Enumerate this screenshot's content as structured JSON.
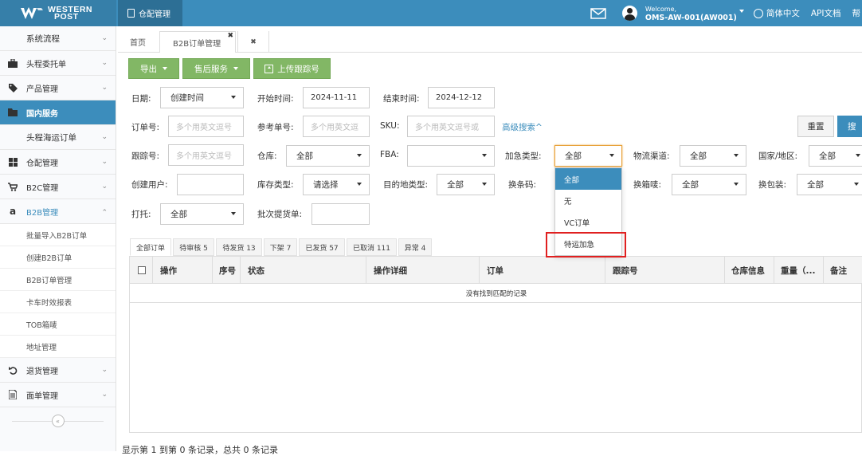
{
  "brand": {
    "line1": "WESTERN",
    "line2": "POST"
  },
  "topnav": {
    "module_tab": "仓配管理",
    "welcome": "Welcome,",
    "account": "OMS-AW-001(AW001)",
    "language": "简体中文",
    "api_docs": "API文档",
    "help": "帮"
  },
  "sidebar": {
    "items": [
      {
        "label": "系统流程",
        "icon": "",
        "chevron": "⌄"
      },
      {
        "label": "头程委托单",
        "icon": "briefcase-icon",
        "chevron": "⌄"
      },
      {
        "label": "产品管理",
        "icon": "tag-icon",
        "chevron": "⌄"
      },
      {
        "label": "国内服务",
        "icon": "folder-icon",
        "chevron": ""
      },
      {
        "label": "头程海运订单",
        "icon": "",
        "chevron": "⌄"
      },
      {
        "label": "仓配管理",
        "icon": "grid-icon",
        "chevron": "⌄"
      },
      {
        "label": "B2C管理",
        "icon": "cart-icon",
        "chevron": "⌄"
      },
      {
        "label": "B2B管理",
        "icon": "amazon-icon",
        "chevron": "⌃"
      }
    ],
    "b2b_sub": [
      "批量导入B2B订单",
      "创建B2B订单",
      "B2B订单管理",
      "卡车时效报表",
      "TOB箱唛",
      "地址管理"
    ],
    "bottom_items": [
      {
        "label": "退货管理",
        "icon": "undo-icon",
        "chevron": "⌄"
      },
      {
        "label": "面单管理",
        "icon": "document-icon",
        "chevron": "⌄"
      }
    ],
    "collapse_symbol": "«"
  },
  "page_tabs": {
    "home": "首页",
    "current": "B2B订单管理",
    "close": "✖",
    "close_all": "✖"
  },
  "toolbar": {
    "export": "导出",
    "aftersales": "售后服务",
    "upload": "上传跟踪号"
  },
  "filters": {
    "date_label": "日期:",
    "date_value": "创建时间",
    "start_label": "开始时间:",
    "start_value": "2024-11-11",
    "end_label": "结束时间:",
    "end_value": "2024-12-12",
    "order_label": "订单号:",
    "order_placeholder": "多个用英文逗号",
    "ref_label": "参考单号:",
    "ref_placeholder": "多个用英文逗",
    "sku_label": "SKU:",
    "sku_placeholder": "多个用英文逗号或",
    "advanced": "高级搜索^",
    "reset": "重置",
    "search": "搜",
    "tracking_label": "跟踪号:",
    "tracking_placeholder": "多个用英文逗号",
    "warehouse_label": "仓库:",
    "warehouse_value": "全部",
    "fba_label": "FBA:",
    "fba_value": "",
    "urgent_label": "加急类型:",
    "urgent_value": "全部",
    "channel_label": "物流渠道:",
    "channel_value": "全部",
    "country_label": "国家/地区:",
    "country_value": "全部",
    "creator_label": "创建用户:",
    "stock_label": "库存类型:",
    "stock_value": "请选择",
    "dest_label": "目的地类型:",
    "dest_value": "全部",
    "barcode_label": "换条码:",
    "relabel_label": "换箱唛:",
    "relabel_value": "全部",
    "repack_label": "换包装:",
    "repack_value": "全部",
    "pallet_label": "打托:",
    "pallet_value": "全部",
    "batch_label": "批次提货单:"
  },
  "urgent_dropdown": [
    "全部",
    "无",
    "VC订单",
    "特运加急"
  ],
  "status_tabs": [
    "全部订单",
    "待审核 5",
    "待发货 13",
    "下架 7",
    "已发货 57",
    "已取消 111",
    "异常 4"
  ],
  "table": {
    "headers": [
      "操作",
      "序号",
      "状态",
      "操作详细",
      "订单",
      "跟踪号",
      "仓库信息",
      "重量（...",
      "备注"
    ],
    "empty": "没有找到匹配的记录"
  },
  "footer": "显示第 1 到第 0 条记录，总共 0 条记录",
  "colors": {
    "primary": "#3c8dbc",
    "green": "#82b765",
    "highlight": "#e02020"
  }
}
